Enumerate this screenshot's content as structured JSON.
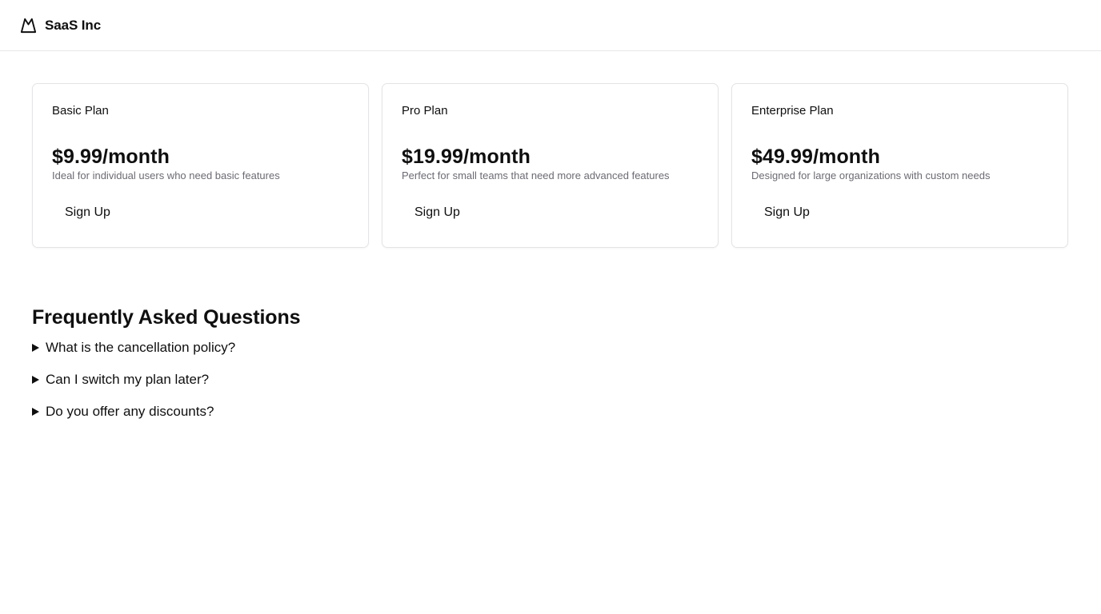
{
  "brand": {
    "name": "SaaS Inc",
    "logo_icon": "mountain-icon"
  },
  "plans": [
    {
      "name": "Basic Plan",
      "price": "$9.99/month",
      "description": "Ideal for individual users who need basic features",
      "cta": "Sign Up"
    },
    {
      "name": "Pro Plan",
      "price": "$19.99/month",
      "description": "Perfect for small teams that need more advanced features",
      "cta": "Sign Up"
    },
    {
      "name": "Enterprise Plan",
      "price": "$49.99/month",
      "description": "Designed for large organizations with custom needs",
      "cta": "Sign Up"
    }
  ],
  "faq": {
    "title": "Frequently Asked Questions",
    "items": [
      {
        "question": "What is the cancellation policy?",
        "icon": "disclosure-triangle-icon"
      },
      {
        "question": "Can I switch my plan later?",
        "icon": "disclosure-triangle-icon"
      },
      {
        "question": "Do you offer any discounts?",
        "icon": "disclosure-triangle-icon"
      }
    ]
  },
  "colors": {
    "text": "#0f0f10",
    "muted": "#6b6b73",
    "border": "#e4e4e7"
  }
}
